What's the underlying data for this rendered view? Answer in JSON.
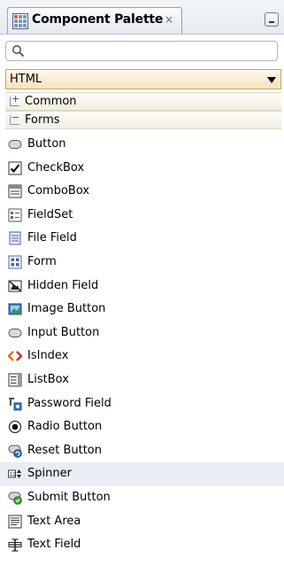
{
  "tab": {
    "title": "Component Palette",
    "close": "×"
  },
  "search": {
    "placeholder": "",
    "value": ""
  },
  "filter": {
    "value": "HTML"
  },
  "categories": [
    {
      "label": "Common",
      "toggle": "+"
    },
    {
      "label": "Forms",
      "toggle": "−"
    }
  ],
  "items": [
    {
      "label": "Button",
      "icon": "button-icon"
    },
    {
      "label": "CheckBox",
      "icon": "checkbox-icon"
    },
    {
      "label": "ComboBox",
      "icon": "combobox-icon"
    },
    {
      "label": "FieldSet",
      "icon": "fieldset-icon"
    },
    {
      "label": "File Field",
      "icon": "file-field-icon"
    },
    {
      "label": "Form",
      "icon": "form-icon"
    },
    {
      "label": "Hidden Field",
      "icon": "hidden-field-icon"
    },
    {
      "label": "Image Button",
      "icon": "image-button-icon"
    },
    {
      "label": "Input Button",
      "icon": "input-button-icon"
    },
    {
      "label": "IsIndex",
      "icon": "isindex-icon"
    },
    {
      "label": "ListBox",
      "icon": "listbox-icon"
    },
    {
      "label": "Password Field",
      "icon": "password-field-icon"
    },
    {
      "label": "Radio Button",
      "icon": "radio-button-icon"
    },
    {
      "label": "Reset Button",
      "icon": "reset-button-icon"
    },
    {
      "label": "Spinner",
      "icon": "spinner-icon",
      "selected": true
    },
    {
      "label": "Submit Button",
      "icon": "submit-button-icon"
    },
    {
      "label": "Text Area",
      "icon": "text-area-icon"
    },
    {
      "label": "Text Field",
      "icon": "text-field-icon"
    }
  ]
}
